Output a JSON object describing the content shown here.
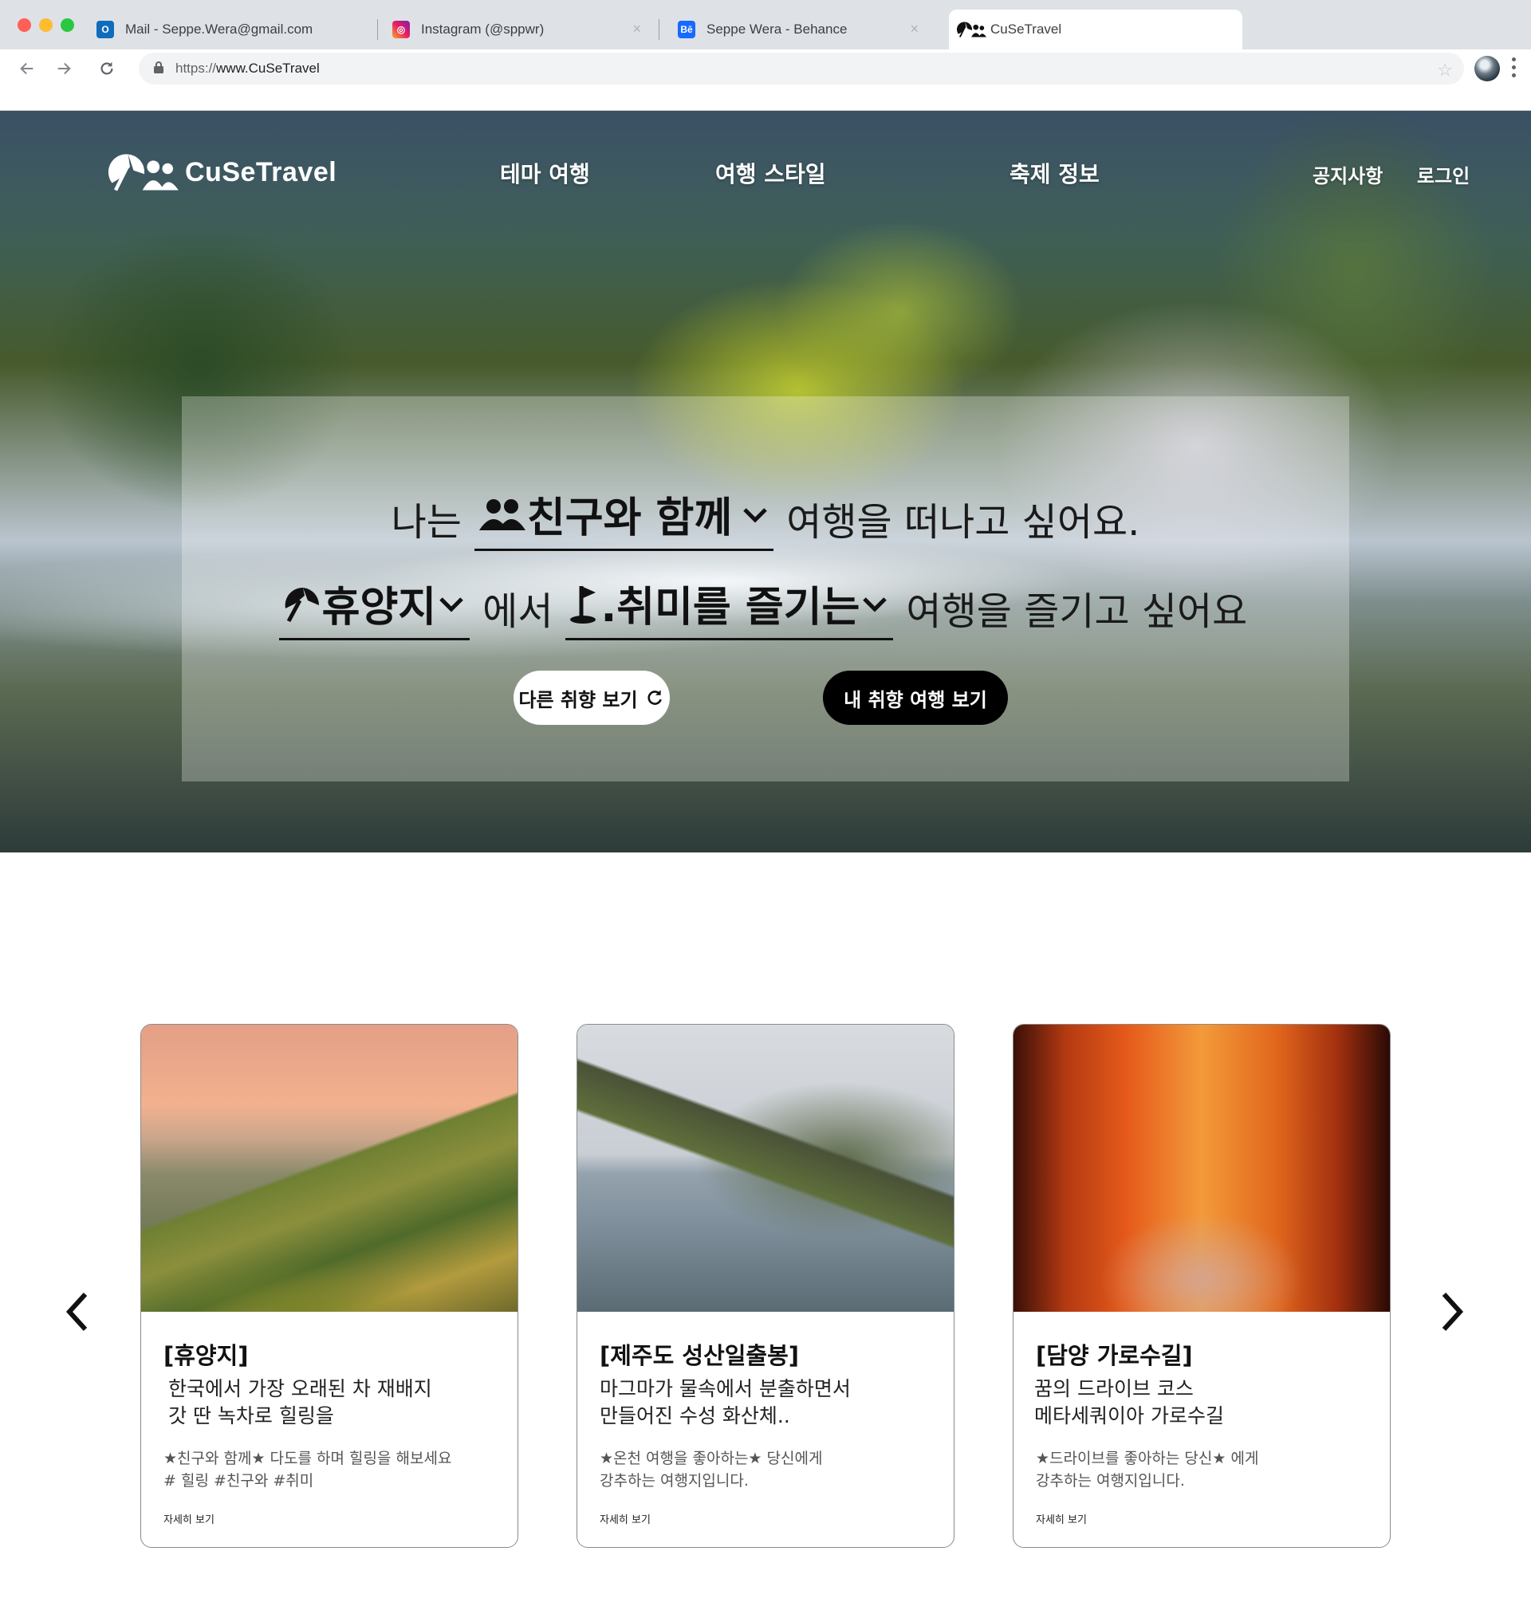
{
  "browser": {
    "tabs": [
      {
        "label": "Mail - Seppe.Wera@gmail.com",
        "icon": "outlook-icon"
      },
      {
        "label": "Instagram (@sppwr)",
        "icon": "instagram-icon"
      },
      {
        "label": "Seppe Wera - Behance",
        "icon": "behance-icon"
      },
      {
        "label": "CuSeTravel",
        "icon": "cusetravel-icon"
      }
    ],
    "url_protocol": "https://",
    "url_host": "www.CuSeTravel"
  },
  "site": {
    "logo_text": "CuSeTravel",
    "nav": [
      "테마 여행",
      "여행 스타일",
      "축제 정보"
    ],
    "nav_right": [
      "공지사항",
      "로그인"
    ]
  },
  "hero": {
    "line1_prefix": "나는",
    "companion_select": "친구와 함께",
    "line1_suffix": "여행을 떠나고 싶어요.",
    "place_select": "휴양지",
    "line2_middle": "에서",
    "activity_select": ".취미를 즐기는",
    "line2_suffix": "여행을 즐기고 싶어요",
    "btn_other": "다른 취향 보기",
    "btn_mine": "내 취향 여행 보기"
  },
  "cards": [
    {
      "title": "[휴양지]",
      "desc": [
        "한국에서 가장 오래된 차 재배지",
        "갓 딴 녹차로 힐링을"
      ],
      "tags": [
        "★친구와 함께★ 다도를 하며 힐링을 해보세요",
        "# 힐링 #친구와 #취미"
      ],
      "more": "자세히 보기"
    },
    {
      "title": "[제주도 성산일출봉]",
      "desc": [
        "마그마가 물속에서 분출하면서",
        "만들어진 수성 화산체.."
      ],
      "tags": [
        "★온천 여행을 좋아하는★ 당신에게",
        "강추하는 여행지입니다."
      ],
      "more": "자세히 보기"
    },
    {
      "title": "[담양 가로수길]",
      "desc": [
        "꿈의 드라이브 코스",
        "메타세쿼이아 가로수길"
      ],
      "tags": [
        "★드라이브를 좋아하는 당신★ 에게",
        "강추하는 여행지입니다."
      ],
      "more": "자세히 보기"
    }
  ]
}
